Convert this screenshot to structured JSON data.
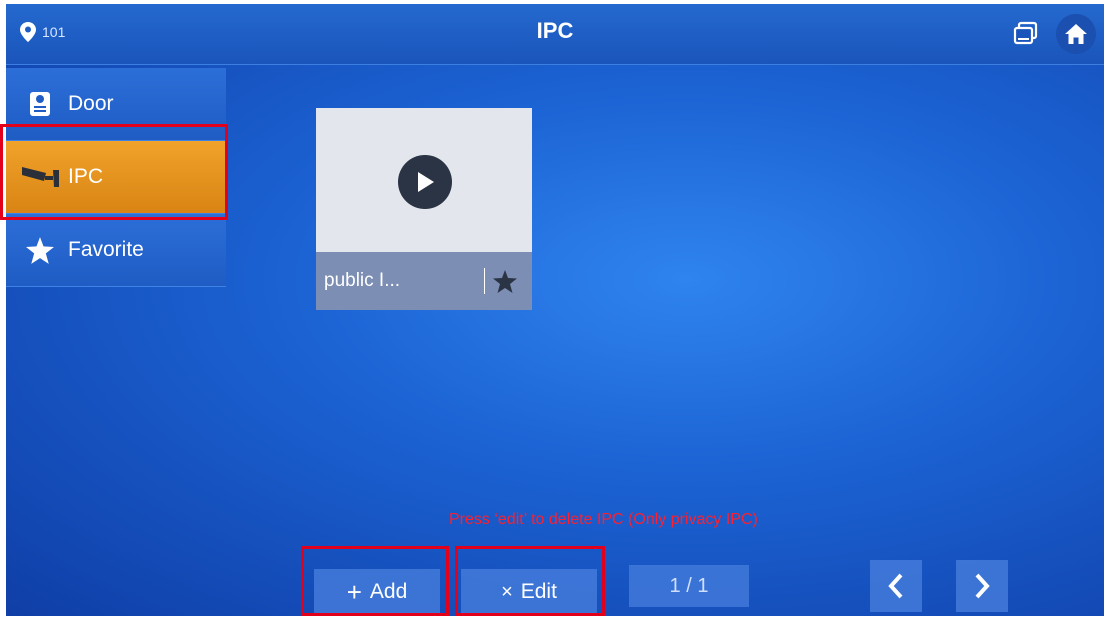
{
  "header": {
    "room_number": "101",
    "title": "IPC",
    "icons": [
      "location-pin-icon",
      "monitor-icon",
      "home-icon"
    ]
  },
  "sidebar": {
    "items": [
      {
        "label": "Door",
        "icon": "door-intercom-icon",
        "active": false
      },
      {
        "label": "IPC",
        "icon": "camera-icon",
        "active": true
      },
      {
        "label": "Favorite",
        "icon": "star-icon",
        "active": false
      }
    ]
  },
  "main": {
    "cards": [
      {
        "name": "public I...",
        "icon": "play-icon",
        "favorite_icon": "star-icon"
      }
    ]
  },
  "annotation": "Press ‘edit’ to delete IPC (Only privacy IPC)",
  "footer": {
    "add_symbol": "+",
    "add_label": "Add",
    "edit_symbol": "×",
    "edit_label": "Edit",
    "page_indicator": "1 / 1",
    "prev_icon": "chevron-left-icon",
    "next_icon": "chevron-right-icon"
  },
  "colors": {
    "background": "#1c63d4",
    "active_item": "#e8961f",
    "highlight_box": "#e3001b",
    "annotation_text": "#ff1f2e"
  }
}
